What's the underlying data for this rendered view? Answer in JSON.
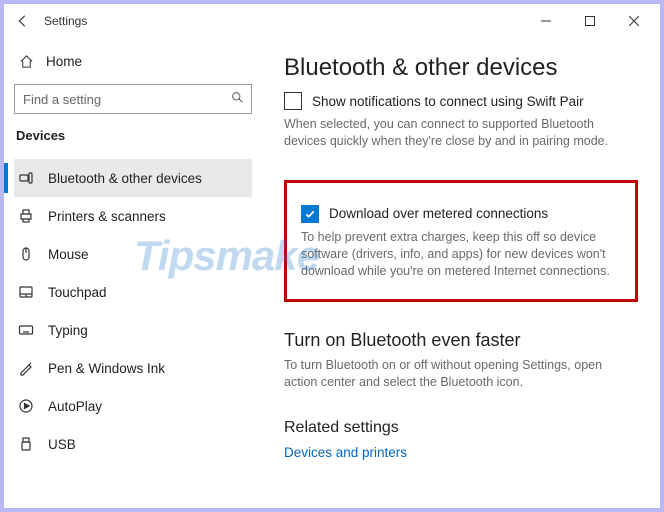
{
  "app": {
    "title": "Settings"
  },
  "sidebar": {
    "home": "Home",
    "search_placeholder": "Find a setting",
    "section": "Devices",
    "items": [
      {
        "label": "Bluetooth & other devices"
      },
      {
        "label": "Printers & scanners"
      },
      {
        "label": "Mouse"
      },
      {
        "label": "Touchpad"
      },
      {
        "label": "Typing"
      },
      {
        "label": "Pen & Windows Ink"
      },
      {
        "label": "AutoPlay"
      },
      {
        "label": "USB"
      }
    ]
  },
  "main": {
    "title": "Bluetooth & other devices",
    "swift_pair": {
      "label": "Show notifications to connect using Swift Pair",
      "desc": "When selected, you can connect to supported Bluetooth devices quickly when they're close by and in pairing mode."
    },
    "metered": {
      "label": "Download over metered connections",
      "desc": "To help prevent extra charges, keep this off so device software (drivers, info, and apps) for new devices won't download while you're on metered Internet connections."
    },
    "faster": {
      "title": "Turn on Bluetooth even faster",
      "desc": "To turn Bluetooth on or off without opening Settings, open action center and select the Bluetooth icon."
    },
    "related": {
      "title": "Related settings",
      "link": "Devices and printers"
    }
  },
  "watermark": "Tipsmake"
}
